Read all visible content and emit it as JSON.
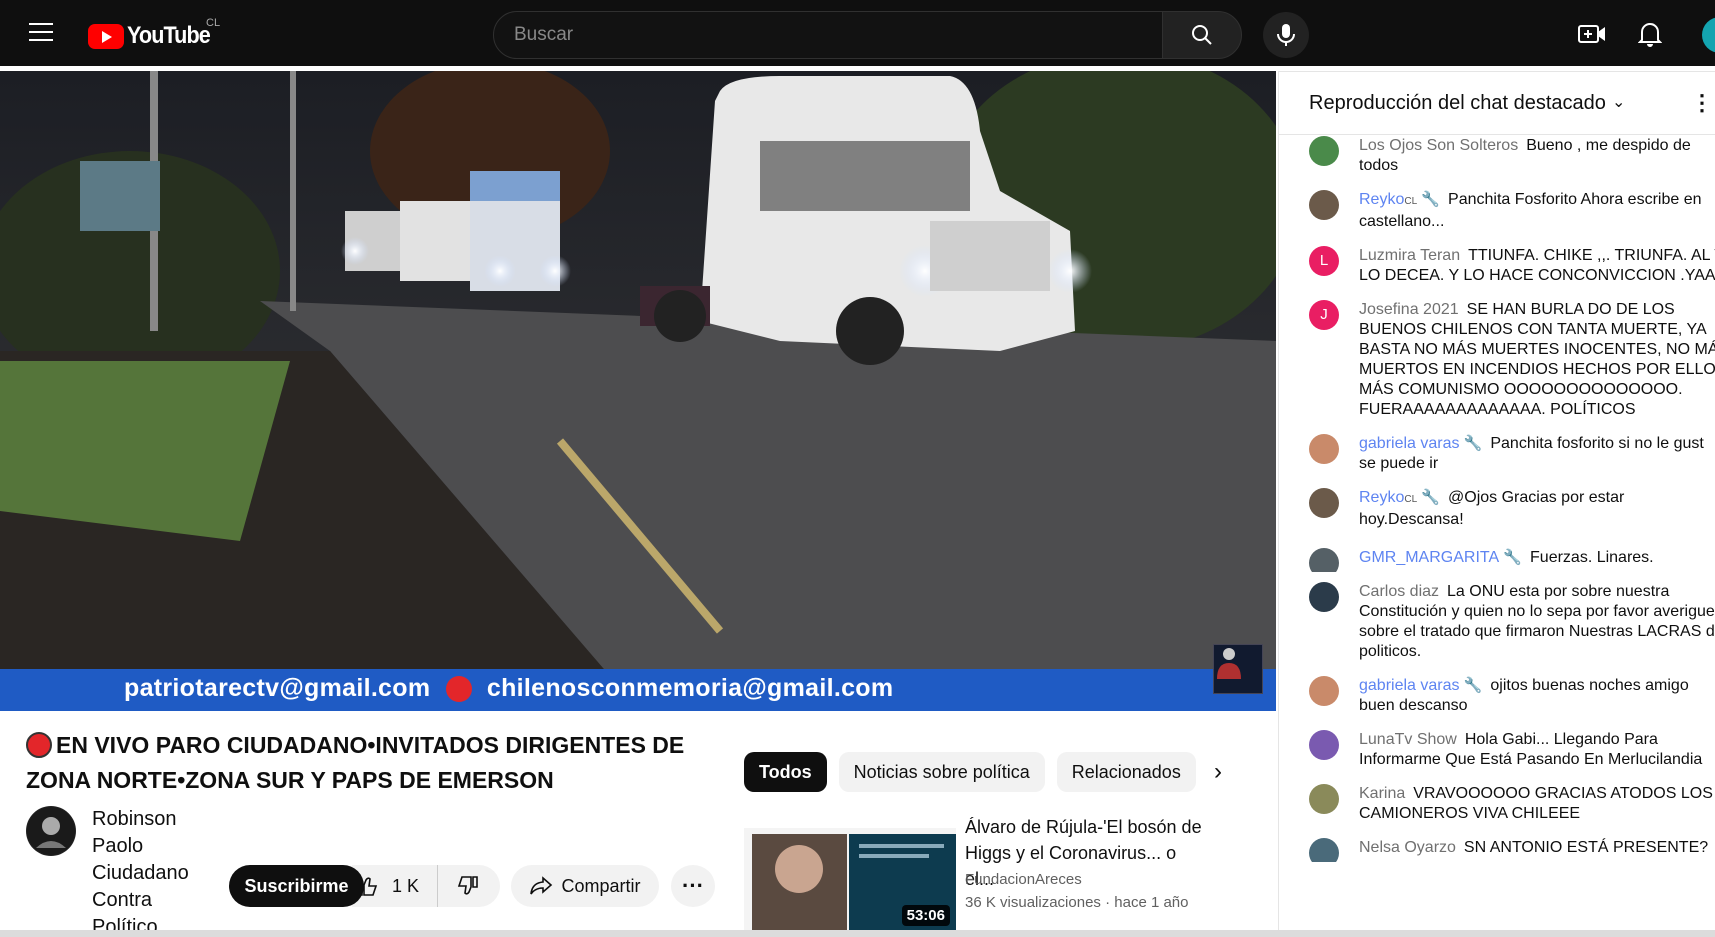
{
  "topbar": {
    "brand": "YouTube",
    "country": "CL",
    "search_placeholder": "Buscar"
  },
  "video": {
    "banner_email_1": "patriotarectv@gmail.com",
    "banner_email_2": "chilenosconmemoria@gmail.com"
  },
  "meta": {
    "title": "EN VIVO PARO CIUDADANO•INVITADOS DIRIGENTES DE ZONA NORTE•ZONA SUR Y PAPS DE EMERSON",
    "channel_name": "Robinson Paolo Ciudadano Contra Político",
    "subscribe_label": "Suscribirme",
    "like_count": "1 K",
    "share_label": "Compartir"
  },
  "chips": [
    "Todos",
    "Noticias sobre política",
    "Relacionados"
  ],
  "recommendation": {
    "title": "Álvaro de Rújula-'El bosón de Higgs y el Coronavirus... o el...",
    "channel": "FundacionAreces",
    "views": "36 K visualizaciones",
    "age": "hace 1 año",
    "duration": "53:06"
  },
  "chat": {
    "title": "Reproducción del chat destacado",
    "messages": [
      {
        "author": "Los Ojos Son Solteros",
        "line1": "Bueno , me despido de",
        "line2": "todos",
        "mod": false,
        "color": "#4a8a4a",
        "initial": ""
      },
      {
        "author": "Reyko",
        "badge": "CL",
        "line1": "Panchita Fosforito Ahora escribe en",
        "line2": "castellano...",
        "mod": true,
        "color": "#6b5a4a",
        "initial": ""
      },
      {
        "author": "Luzmira Teran",
        "line1": "TTIUNFA. CHIKE ,,. TRIUNFA. AL V",
        "line2": "LO DECEA. Y LO HACE CONCONVICCION .YAAAA",
        "mod": false,
        "color": "#e91e63",
        "initial": "L"
      },
      {
        "author": "Josefina 2021",
        "line1": "SE HAN BURLA DO DE LOS",
        "line2": "BUENOS CHILENOS CON TANTA MUERTE, YA",
        "line3": "BASTA NO MÁS MUERTES INOCENTES, NO MÁS",
        "line4": "MUERTOS EN INCENDIOS HECHOS POR ELLOS, N",
        "line5": "MÁS COMUNISMO OOOOOOOOOOOOOO.",
        "line6": "FUERAAAAAAAAAAAAA. POLÍTICOS",
        "mod": false,
        "color": "#e91e63",
        "initial": "J"
      },
      {
        "author": "gabriela varas",
        "line1": "Panchita fosforito si no le gust",
        "line2": "se puede ir",
        "mod": true,
        "color": "#c98a6a",
        "initial": ""
      },
      {
        "author": "Reyko",
        "badge": "CL",
        "line1": "@Ojos Gracias por estar",
        "line2": "hoy.Descansa!",
        "mod": true,
        "color": "#6b5a4a",
        "initial": ""
      },
      {
        "author": "GMR_MARGARITA",
        "line1": "Fuerzas. Linares.",
        "mod": true,
        "color": "#556066",
        "initial": ""
      },
      {
        "author": "Carlos diaz",
        "line1": "La ONU esta por sobre nuestra",
        "line2": "Constitución y quien no lo sepa por favor averigue",
        "line3": "sobre el tratado que firmaron Nuestras LACRAS d",
        "line4": "politicos.",
        "mod": false,
        "color": "#2b3b4a",
        "initial": ""
      },
      {
        "author": "gabriela varas",
        "line1": "ojitos buenas noches amigo",
        "line2": "buen descanso",
        "mod": true,
        "color": "#c98a6a",
        "initial": ""
      },
      {
        "author": "LunaTv Show",
        "line1": "Hola Gabi... Llegando Para",
        "line2": "Informarme Que Está Pasando En Merlucilandia",
        "mod": false,
        "color": "#7a5ab0",
        "initial": ""
      },
      {
        "author": "Karina",
        "line1": "VRAVOOOOOO GRACIAS ATODOS LOS",
        "line2": "CAMIONEROS VIVA CHILEEE",
        "mod": false,
        "color": "#8a8a5a",
        "initial": ""
      },
      {
        "author": "Nelsa Oyarzo",
        "line1": "SN ANTONIO ESTÁ PRESENTE?",
        "mod": false,
        "color": "#4a6a7a",
        "initial": ""
      }
    ]
  }
}
